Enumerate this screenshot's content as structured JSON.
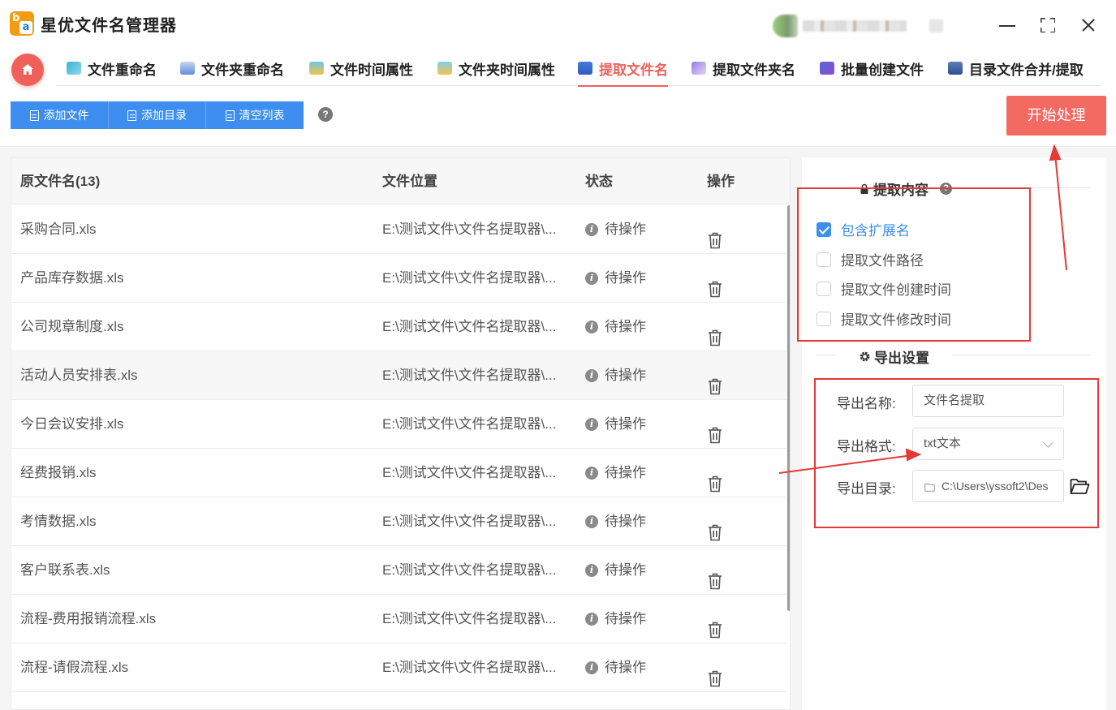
{
  "app": {
    "title": "星优文件名管理器"
  },
  "nav": {
    "items": [
      {
        "label": "文件重命名",
        "icon": "rename-file-icon"
      },
      {
        "label": "文件夹重命名",
        "icon": "rename-folder-icon"
      },
      {
        "label": "文件时间属性",
        "icon": "file-time-icon"
      },
      {
        "label": "文件夹时间属性",
        "icon": "folder-time-icon"
      },
      {
        "label": "提取文件名",
        "icon": "extract-filename-icon",
        "active": true
      },
      {
        "label": "提取文件夹名",
        "icon": "extract-foldername-icon"
      },
      {
        "label": "批量创建文件",
        "icon": "batch-create-icon"
      },
      {
        "label": "目录文件合并/提取",
        "icon": "merge-extract-icon"
      }
    ]
  },
  "toolbar": {
    "add_file": "添加文件",
    "add_dir": "添加目录",
    "clear_list": "清空列表",
    "help": "?",
    "start": "开始处理"
  },
  "table": {
    "headers": {
      "name": "原文件名(13)",
      "path": "文件位置",
      "status": "状态",
      "op": "操作"
    },
    "rows": [
      {
        "name": "采购合同.xls",
        "path": "E:\\测试文件\\文件名提取器\\...",
        "status": "待操作"
      },
      {
        "name": "产品库存数据.xls",
        "path": "E:\\测试文件\\文件名提取器\\...",
        "status": "待操作"
      },
      {
        "name": "公司规章制度.xls",
        "path": "E:\\测试文件\\文件名提取器\\...",
        "status": "待操作"
      },
      {
        "name": "活动人员安排表.xls",
        "path": "E:\\测试文件\\文件名提取器\\...",
        "status": "待操作"
      },
      {
        "name": "今日会议安排.xls",
        "path": "E:\\测试文件\\文件名提取器\\...",
        "status": "待操作"
      },
      {
        "name": "经费报销.xls",
        "path": "E:\\测试文件\\文件名提取器\\...",
        "status": "待操作"
      },
      {
        "name": "考情数据.xls",
        "path": "E:\\测试文件\\文件名提取器\\...",
        "status": "待操作"
      },
      {
        "name": "客户联系表.xls",
        "path": "E:\\测试文件\\文件名提取器\\...",
        "status": "待操作"
      },
      {
        "name": "流程-费用报销流程.xls",
        "path": "E:\\测试文件\\文件名提取器\\...",
        "status": "待操作"
      },
      {
        "name": "流程-请假流程.xls",
        "path": "E:\\测试文件\\文件名提取器\\...",
        "status": "待操作"
      }
    ]
  },
  "panel": {
    "extract_title": "提取内容",
    "options": [
      {
        "label": "包含扩展名",
        "checked": true
      },
      {
        "label": "提取文件路径",
        "checked": false
      },
      {
        "label": "提取文件创建时间",
        "checked": false
      },
      {
        "label": "提取文件修改时间",
        "checked": false
      }
    ],
    "export_title": "导出设置",
    "export_name_label": "导出名称:",
    "export_name_value": "文件名提取",
    "export_format_label": "导出格式:",
    "export_format_value": "txt文本",
    "export_dir_label": "导出目录:",
    "export_dir_value": "C:\\Users\\yssoft2\\Des"
  },
  "colors": {
    "accent": "#f0605a",
    "primary": "#3d8ef0",
    "annotation": "#e53935"
  }
}
